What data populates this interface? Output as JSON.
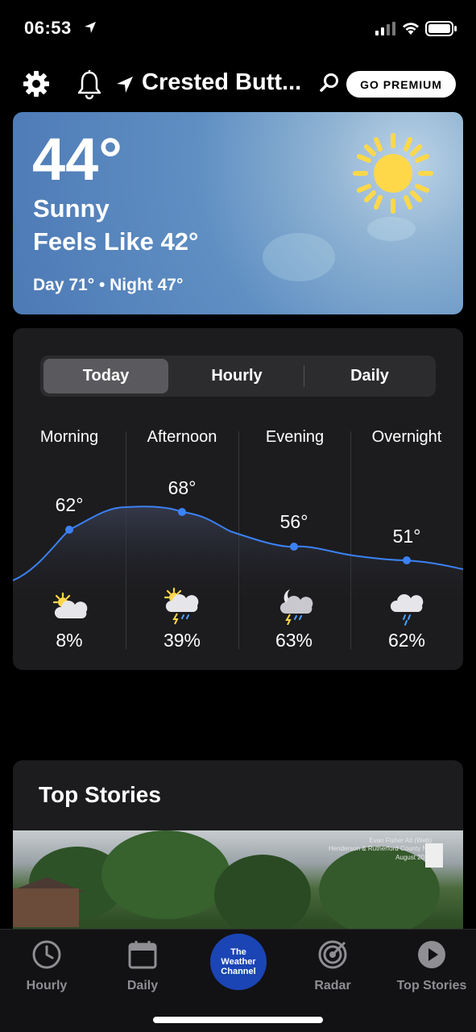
{
  "status": {
    "time": "06:53"
  },
  "header": {
    "location": "Crested Butt...",
    "premium_label": "GO PREMIUM"
  },
  "current": {
    "temperature": "44°",
    "condition": "Sunny",
    "feels_like": "Feels Like 42°",
    "day_night": "Day 71° • Night 47°"
  },
  "forecast": {
    "tabs": [
      "Today",
      "Hourly",
      "Daily"
    ],
    "selected_tab": "Today",
    "periods": [
      {
        "label": "Morning",
        "temp": "62°",
        "precip": "8%",
        "icon": "partly-cloudy-icon"
      },
      {
        "label": "Afternoon",
        "temp": "68°",
        "precip": "39%",
        "icon": "thunderstorm-sun-icon"
      },
      {
        "label": "Evening",
        "temp": "56°",
        "precip": "63%",
        "icon": "thunderstorm-night-icon"
      },
      {
        "label": "Overnight",
        "temp": "51°",
        "precip": "62%",
        "icon": "rain-cloud-icon"
      }
    ],
    "colors": {
      "line": "#3b82f6",
      "point": "#3b82f6"
    }
  },
  "stories": {
    "title": "Top Stories",
    "caption_line1": "Evan Fisher Atl (Web)",
    "caption_line2": "Henderson & Rutherford County NC",
    "caption_line3": "August 2021"
  },
  "tabbar": {
    "items": [
      {
        "label": "Hourly",
        "icon": "clock-icon"
      },
      {
        "label": "Daily",
        "icon": "calendar-icon"
      },
      {
        "label": "The Weather Channel",
        "icon": "twc-logo"
      },
      {
        "label": "Radar",
        "icon": "radar-icon"
      },
      {
        "label": "Top Stories",
        "icon": "play-icon"
      }
    ],
    "logo_text": "The Weather Channel",
    "brand_color": "#1b45b5"
  }
}
